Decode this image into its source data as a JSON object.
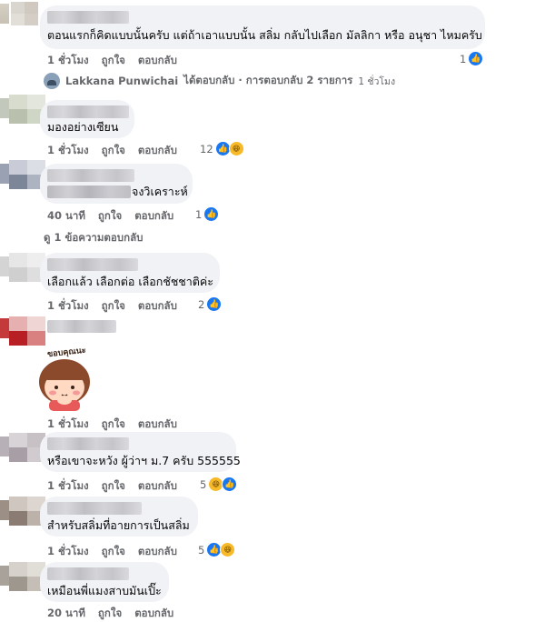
{
  "actions": {
    "like": "ถูกใจ",
    "reply": "ตอบกลับ"
  },
  "comments": [
    {
      "text": "ตอนแรกก็คิดแบบนั้นครับ แต่ถ้าเอาแบบนั้น สลิ่ม กลับไปเลือก มัลลิกา หรือ อนุชา ไหมครับ",
      "time": "1 ชั่วโมง",
      "reactions": "1"
    },
    {
      "text": "มองอย่างเซียน",
      "time": "1 ชั่วโมง",
      "reactions": "12"
    },
    {
      "text": "จงวิเคราะห์",
      "time": "40 นาที",
      "reactions": "1"
    },
    {
      "text": "เลือกแล้ว เลือกต่อ เลือกชัชชาติค่ะ",
      "time": "1 ชั่วโมง",
      "reactions": "2"
    },
    {
      "sticker_text": "ขอบคุณนะ",
      "time": "1 ชั่วโมง"
    },
    {
      "text": "หรือเขาจะหวัง ผู้ว่าฯ ม.7 ครับ 555555",
      "time": "1 ชั่วโมง",
      "reactions": "5"
    },
    {
      "text": "สำหรับสลิ่มที่อายการเป็นสลิ่ม",
      "time": "1 ชั่วโมง",
      "reactions": "5"
    },
    {
      "text": "เหมือนพี่แมงสาบมันเปิ๊ะ",
      "time": "20 นาที"
    }
  ],
  "reply_summary": {
    "name": "Lakkana Punwichai",
    "text": "ได้ตอบกลับ · การตอบกลับ 2 รายการ",
    "time": "1 ชั่วโมง"
  },
  "view_replies": "ดู 1 ข้อความตอบกลับ",
  "icons": {
    "like": "like-icon",
    "haha": "haha-icon"
  },
  "colors": {
    "bubble": "#f0f2f5",
    "like": "#1877f2",
    "meta": "#65676b"
  }
}
